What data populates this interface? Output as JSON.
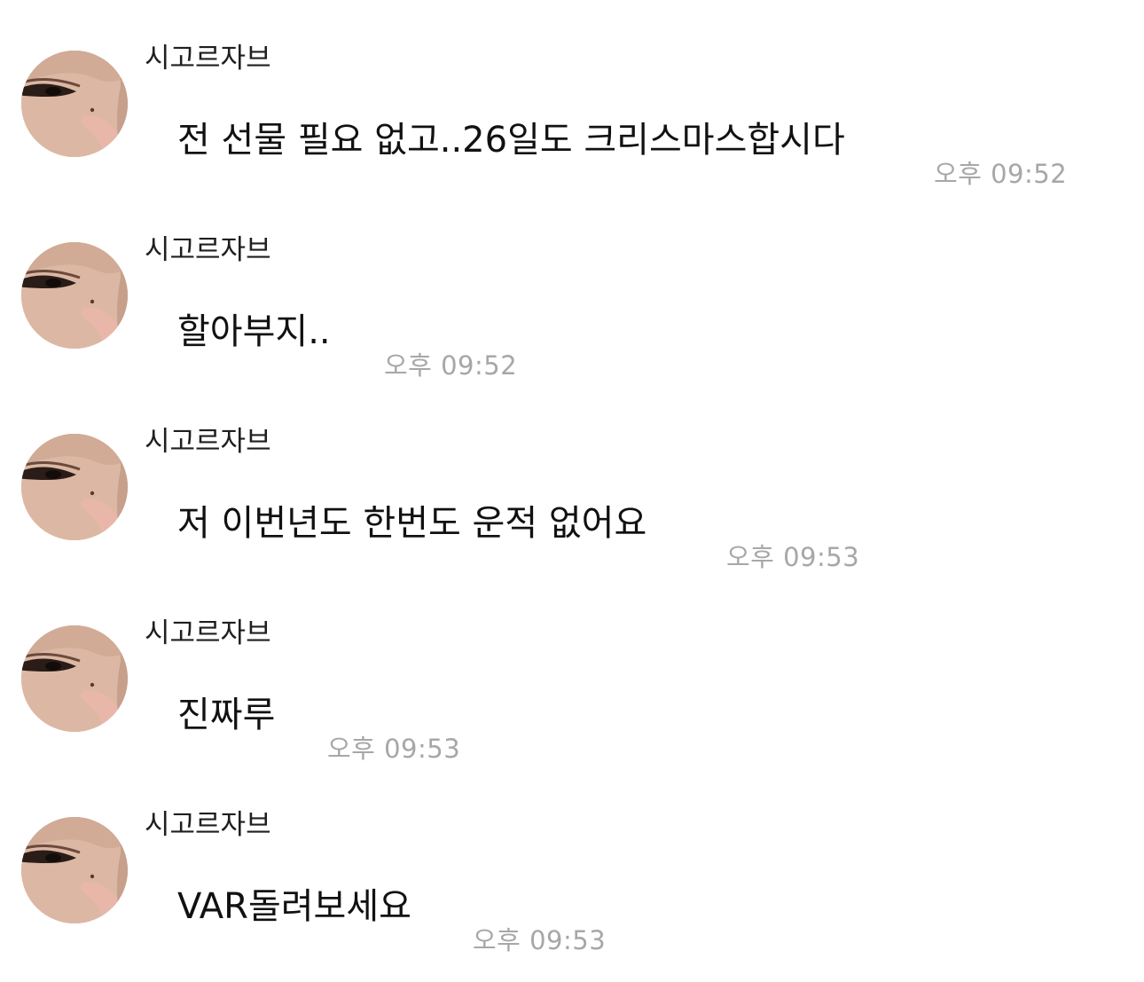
{
  "messages": [
    {
      "sender": "시고르자브",
      "text": "전 선물 필요 없고..26일도 크리스마스합시다",
      "time": "오후 09:52"
    },
    {
      "sender": "시고르자브",
      "text": "할아부지..",
      "time": "오후 09:52"
    },
    {
      "sender": "시고르자브",
      "text": "저 이번년도 한번도 운적 없어요",
      "time": "오후 09:53"
    },
    {
      "sender": "시고르자브",
      "text": "진짜루",
      "time": "오후 09:53"
    },
    {
      "sender": "시고르자브",
      "text": "VAR돌려보세요",
      "time": "오후 09:53"
    }
  ],
  "colors": {
    "background": "#ffffff",
    "message_text": "#111111",
    "sender_text": "#1f1f1f",
    "timestamp_text": "#a7a7a7"
  },
  "icons": {
    "avatar": "profile-photo-avatar"
  }
}
